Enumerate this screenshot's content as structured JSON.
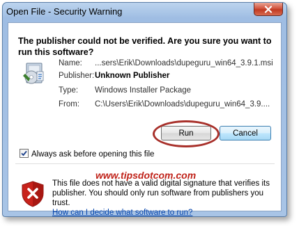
{
  "window": {
    "title": "Open File - Security Warning",
    "close_icon": "close-x-icon"
  },
  "heading": "The publisher could not be verified.  Are you sure you want to run this software?",
  "file_icon": "msi-installer-package-icon",
  "details": {
    "name_label": "Name:",
    "name_value": "...sers\\Erik\\Downloads\\dupeguru_win64_3.9.1.msi",
    "publisher_label": "Publisher:",
    "publisher_value": "Unknown Publisher",
    "type_label": "Type:",
    "type_value": "Windows Installer Package",
    "from_label": "From:",
    "from_value": "C:\\Users\\Erik\\Downloads\\dupeguru_win64_3.9...."
  },
  "buttons": {
    "run": "Run",
    "cancel": "Cancel"
  },
  "checkbox": {
    "label": "Always ask before opening this file",
    "checked": true
  },
  "watermark": "www.tipsdotcom.com",
  "warning": {
    "icon": "red-shield-x-icon",
    "text": "This file does not have a valid digital signature that verifies its publisher.  You should only run software from publishers you trust.",
    "link": "How can I decide what software to run?"
  },
  "colors": {
    "annotation_ellipse": "#a8302a",
    "watermark": "#c0231a",
    "link": "#0645ad",
    "close_button": "#c74a31"
  }
}
